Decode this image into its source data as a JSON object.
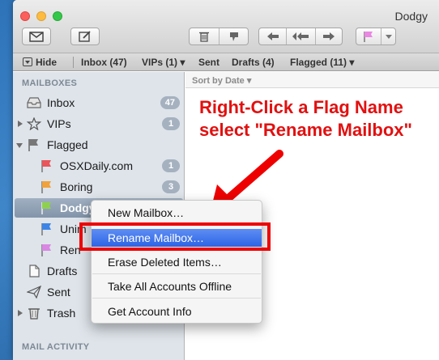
{
  "window": {
    "title": "Dodgy"
  },
  "toolbar": {
    "icons": [
      "compose-icon",
      "new-note-icon",
      "trash-icon",
      "junk-icon",
      "reply-icon",
      "reply-all-icon",
      "forward-icon",
      "flag-icon"
    ],
    "flag_color": "#e987e2"
  },
  "favorites": {
    "hide_label": "Hide",
    "items": [
      "Inbox (47)",
      "VIPs (1) ▾",
      "Sent",
      "Drafts (4)",
      "Flagged (11) ▾"
    ]
  },
  "sidebar": {
    "mailboxes_header": "MAILBOXES",
    "mail_activity_header": "MAIL ACTIVITY",
    "rows": {
      "inbox": {
        "label": "Inbox",
        "badge": "47"
      },
      "vips": {
        "label": "VIPs",
        "badge": "1"
      },
      "flagged": {
        "label": "Flagged"
      },
      "osxdaily": {
        "label": "OSXDaily.com",
        "badge": "1",
        "flag_color": "#e8555a"
      },
      "boring": {
        "label": "Boring",
        "badge": "3",
        "flag_color": "#f0a23c"
      },
      "dodgy": {
        "label": "Dodgy",
        "flag_color": "#8ed04e"
      },
      "unim": {
        "label": "Unim",
        "flag_color": "#3c85e6"
      },
      "ren": {
        "label": "Ren",
        "flag_color": "#d987e2"
      },
      "drafts": {
        "label": "Drafts"
      },
      "sent": {
        "label": "Sent"
      },
      "trash": {
        "label": "Trash"
      }
    }
  },
  "messages": {
    "sort_label": "Sort by Date ▾"
  },
  "annotation": {
    "line1": "Right-Click a Flag Name",
    "line2": "select \"Rename Mailbox\"",
    "color": "#e21010"
  },
  "context_menu": {
    "items": [
      "New Mailbox…",
      "Rename Mailbox…",
      "Erase Deleted Items…",
      "Take All Accounts Offline",
      "Get Account Info"
    ],
    "selected": "Rename Mailbox…"
  }
}
